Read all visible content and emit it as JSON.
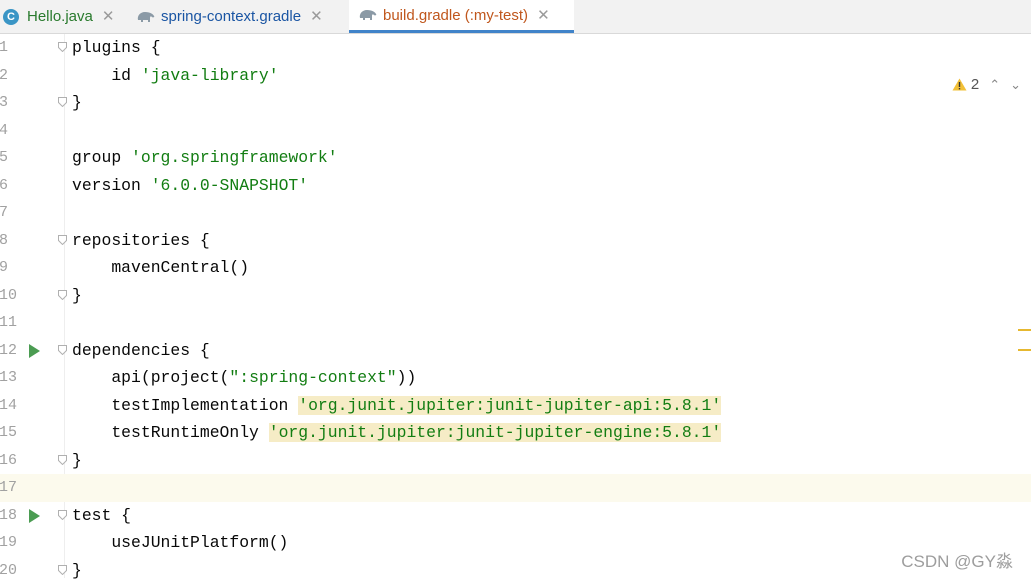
{
  "tabs": [
    {
      "label": "Hello.java",
      "icon": "java-class-icon",
      "icon_letter": "C"
    },
    {
      "label": "spring-context.gradle",
      "icon": "gradle-elephant-icon"
    },
    {
      "label": "build.gradle (:my-test)",
      "icon": "gradle-elephant-icon",
      "active": true
    }
  ],
  "close_glyph": "✕",
  "inspection": {
    "warning_count": "2",
    "up": "⌃",
    "down": "⌄"
  },
  "lines": [
    {
      "n": "1",
      "parts": [
        {
          "t": "plugins {"
        }
      ],
      "fold": true
    },
    {
      "n": "2",
      "parts": [
        {
          "t": "    id "
        },
        {
          "t": "'java-library'",
          "s": "str"
        }
      ]
    },
    {
      "n": "3",
      "parts": [
        {
          "t": "}"
        }
      ],
      "fold": true
    },
    {
      "n": "4",
      "parts": []
    },
    {
      "n": "5",
      "parts": [
        {
          "t": "group "
        },
        {
          "t": "'org.springframework'",
          "s": "str"
        }
      ]
    },
    {
      "n": "6",
      "parts": [
        {
          "t": "version "
        },
        {
          "t": "'6.0.0-SNAPSHOT'",
          "s": "str"
        }
      ]
    },
    {
      "n": "7",
      "parts": []
    },
    {
      "n": "8",
      "parts": [
        {
          "t": "repositories {"
        }
      ],
      "fold": true
    },
    {
      "n": "9",
      "parts": [
        {
          "t": "    mavenCentral()"
        }
      ]
    },
    {
      "n": "10",
      "parts": [
        {
          "t": "}"
        }
      ],
      "fold": true
    },
    {
      "n": "11",
      "parts": []
    },
    {
      "n": "12",
      "parts": [
        {
          "t": "dependencies {"
        }
      ],
      "fold": true,
      "run": true
    },
    {
      "n": "13",
      "parts": [
        {
          "t": "    api(project("
        },
        {
          "t": "\":spring-context\"",
          "s": "str"
        },
        {
          "t": "))"
        }
      ]
    },
    {
      "n": "14",
      "parts": [
        {
          "t": "    testImplementation "
        },
        {
          "t": "'org.junit.jupiter:junit-jupiter-api:5.8.1'",
          "s": "str hl"
        }
      ]
    },
    {
      "n": "15",
      "parts": [
        {
          "t": "    testRuntimeOnly "
        },
        {
          "t": "'org.junit.jupiter:junit-jupiter-engine:5.8.1'",
          "s": "str hl"
        }
      ]
    },
    {
      "n": "16",
      "parts": [
        {
          "t": "}"
        }
      ],
      "fold": true
    },
    {
      "n": "17",
      "parts": [],
      "current": true
    },
    {
      "n": "18",
      "parts": [
        {
          "t": "test {"
        }
      ],
      "fold": true,
      "run": true
    },
    {
      "n": "19",
      "parts": [
        {
          "t": "    useJUnitPlatform()"
        }
      ]
    },
    {
      "n": "20",
      "parts": [
        {
          "t": "}"
        }
      ],
      "fold": true
    }
  ],
  "watermark": "CSDN @GY淼"
}
